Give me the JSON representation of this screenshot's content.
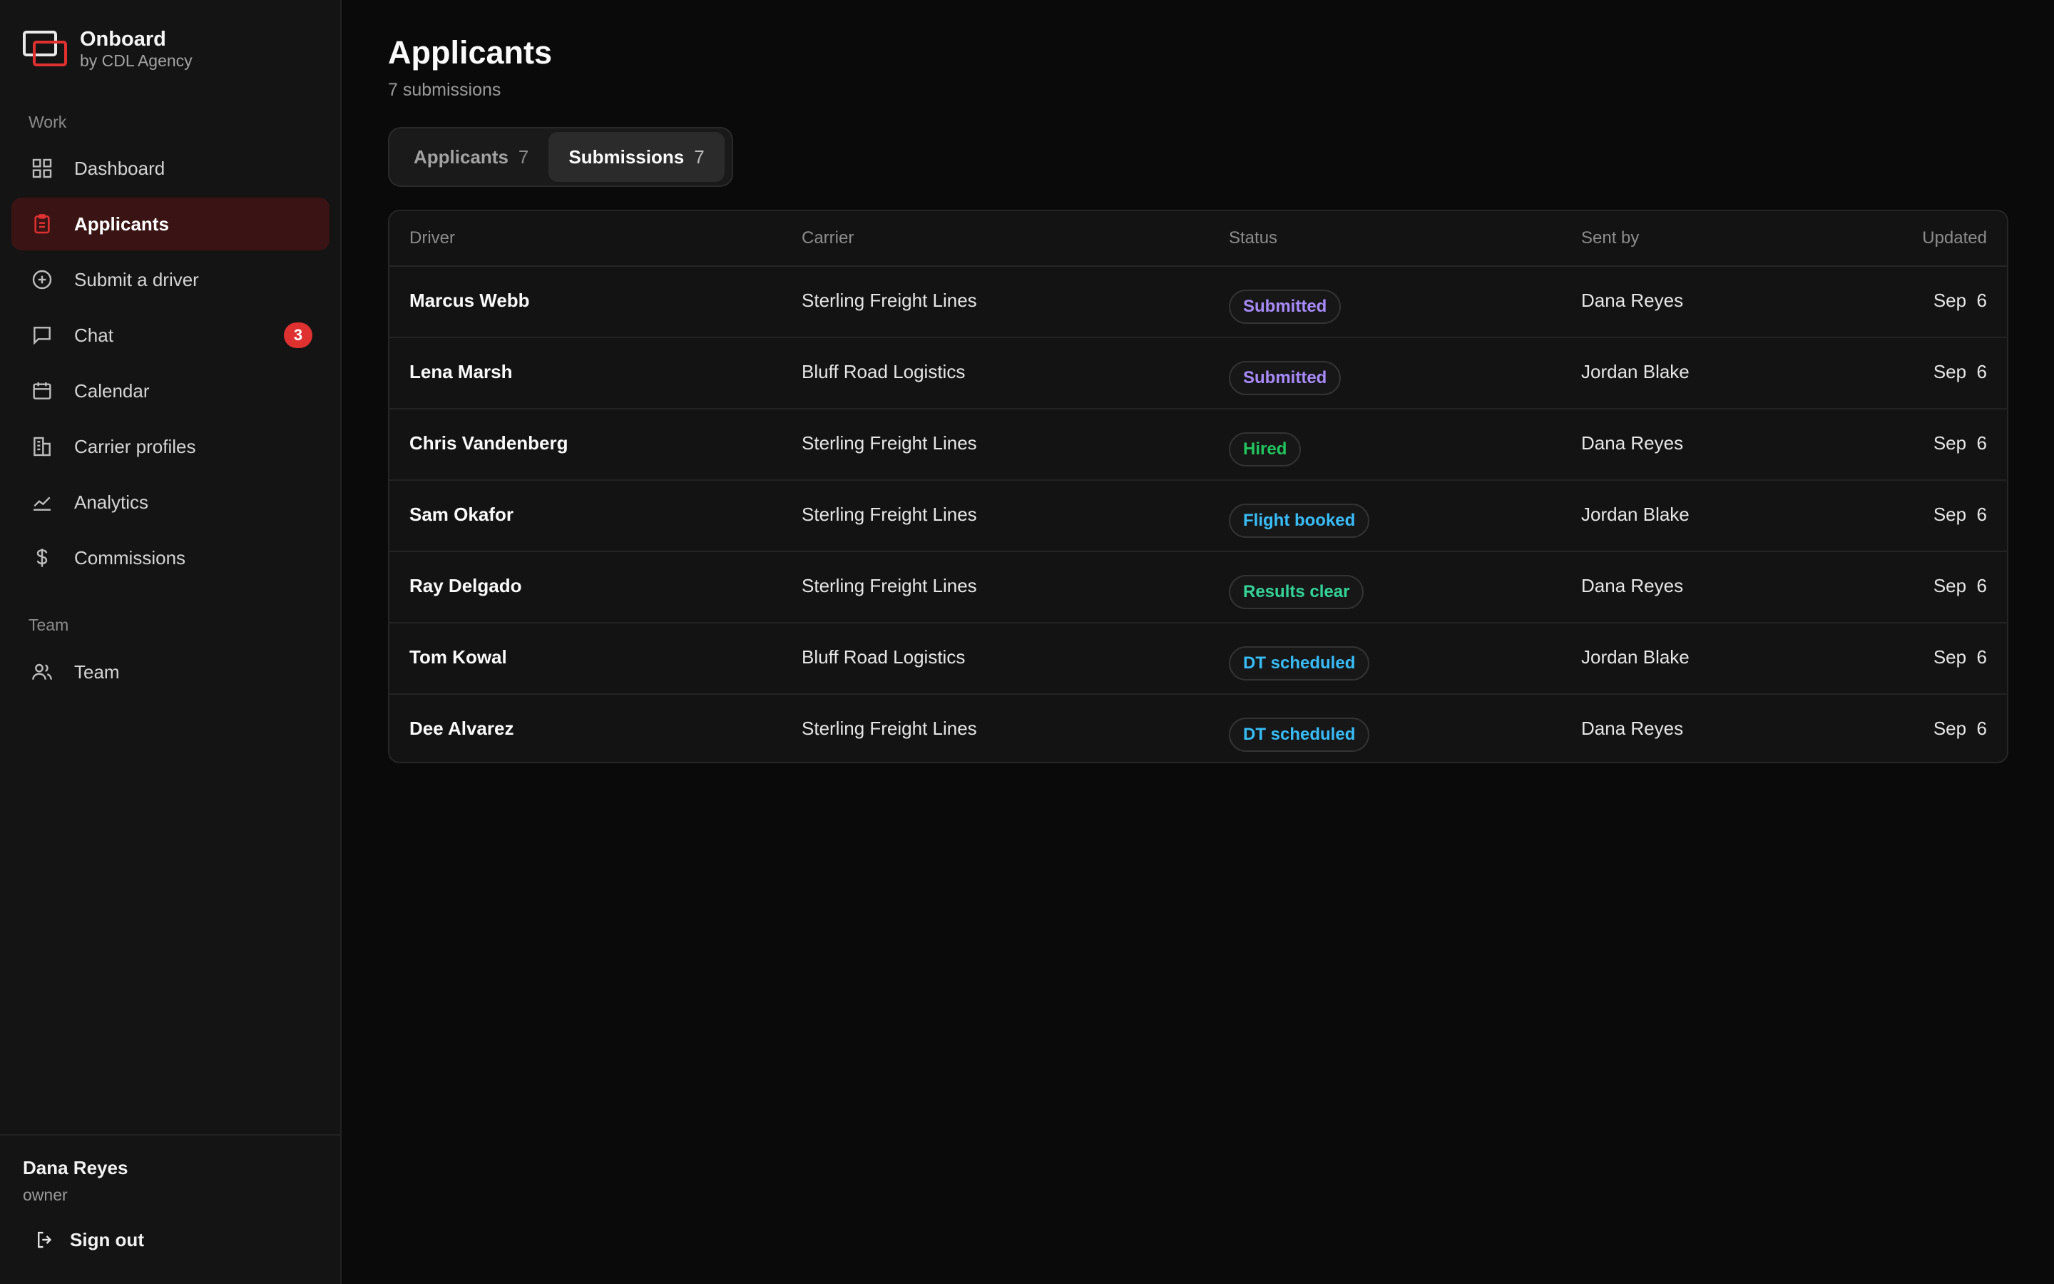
{
  "brand": {
    "name": "Onboard",
    "subtitle": "by CDL Agency"
  },
  "sidebar": {
    "sections": [
      {
        "label": "Work"
      },
      {
        "label": "Team"
      }
    ],
    "items": [
      {
        "label": "Dashboard",
        "icon": "grid-icon"
      },
      {
        "label": "Applicants",
        "icon": "clipboard-icon",
        "active": true
      },
      {
        "label": "Submit a driver",
        "icon": "plus-circle-icon"
      },
      {
        "label": "Chat",
        "icon": "chat-icon",
        "badge": "3"
      },
      {
        "label": "Calendar",
        "icon": "calendar-icon"
      },
      {
        "label": "Carrier profiles",
        "icon": "building-icon"
      },
      {
        "label": "Analytics",
        "icon": "chart-line-icon"
      },
      {
        "label": "Commissions",
        "icon": "dollar-icon"
      },
      {
        "label": "Team",
        "icon": "users-icon"
      }
    ],
    "user": {
      "name": "Dana Reyes",
      "role": "owner"
    },
    "signout_label": "Sign out"
  },
  "page": {
    "title": "Applicants",
    "subtitle": "7 submissions",
    "tabs": [
      {
        "label": "Applicants",
        "count": "7"
      },
      {
        "label": "Submissions",
        "count": "7",
        "active": true
      }
    ]
  },
  "table": {
    "columns": [
      "Driver",
      "Carrier",
      "Status",
      "Sent by",
      "Updated"
    ],
    "rows": [
      {
        "driver": "Marcus Webb",
        "carrier": "Sterling Freight Lines",
        "status": "Submitted",
        "sent_by": "Dana Reyes",
        "updated": "Sep  6"
      },
      {
        "driver": "Lena Marsh",
        "carrier": "Bluff Road Logistics",
        "status": "Submitted",
        "sent_by": "Jordan Blake",
        "updated": "Sep  6"
      },
      {
        "driver": "Chris Vandenberg",
        "carrier": "Sterling Freight Lines",
        "status": "Hired",
        "sent_by": "Dana Reyes",
        "updated": "Sep  6"
      },
      {
        "driver": "Sam Okafor",
        "carrier": "Sterling Freight Lines",
        "status": "Flight booked",
        "sent_by": "Jordan Blake",
        "updated": "Sep  6"
      },
      {
        "driver": "Ray Delgado",
        "carrier": "Sterling Freight Lines",
        "status": "Results clear",
        "sent_by": "Dana Reyes",
        "updated": "Sep  6"
      },
      {
        "driver": "Tom Kowal",
        "carrier": "Bluff Road Logistics",
        "status": "DT scheduled",
        "sent_by": "Jordan Blake",
        "updated": "Sep  6"
      },
      {
        "driver": "Dee Alvarez",
        "carrier": "Sterling Freight Lines",
        "status": "DT scheduled",
        "sent_by": "Dana Reyes",
        "updated": "Sep  6"
      }
    ]
  },
  "colors": {
    "accent": "#e03131",
    "status_submitted": "#a78bfa",
    "status_hired": "#22c55e",
    "status_flight": "#38bdf8",
    "status_clear": "#34d399",
    "status_dt": "#38bdf8"
  }
}
